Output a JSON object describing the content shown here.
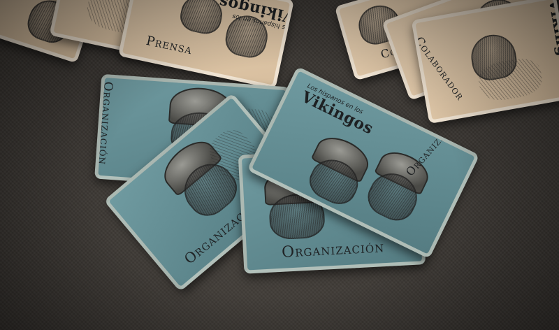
{
  "scene": {
    "background_color": "#3a3632",
    "card_teal": "#6f9aa0",
    "card_tan": "#e7d0b2"
  },
  "cards": {
    "organizacion_label": "Organización",
    "prensa_label": "Prensa",
    "colaborador_label": "Colaborador",
    "brand_small": "Los hispanos en los",
    "brand_big": "Vikingos"
  }
}
